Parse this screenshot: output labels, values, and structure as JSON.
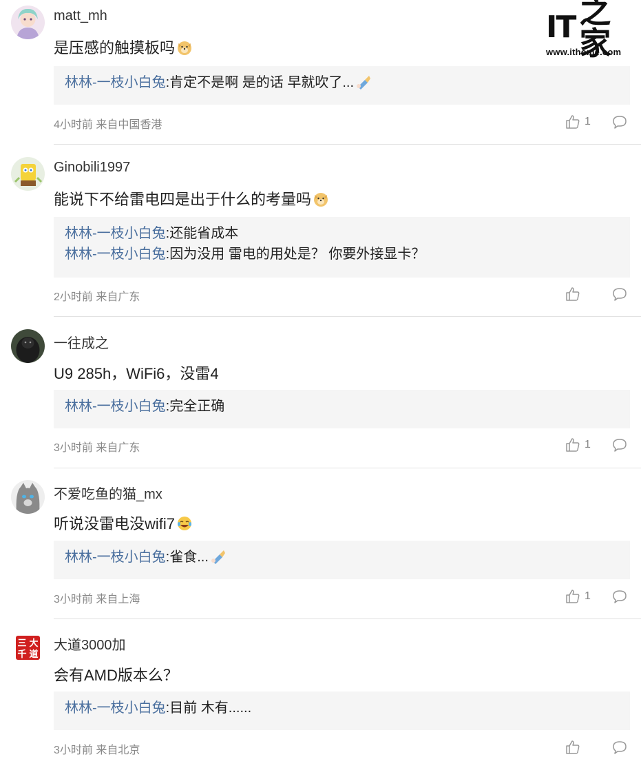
{
  "watermark": {
    "logo_text": "IT",
    "logo_hanzi": "之家",
    "url": "www.ithome.com"
  },
  "comments": [
    {
      "username": "matt_mh",
      "content": "是压感的触摸板吗",
      "content_emoji": "doge-emoji",
      "replies": [
        {
          "author": "林林-一枝小白兔",
          "text": ":肯定不是啊 是的话 早就吹了...",
          "emoji": "blow-horn-emoji"
        }
      ],
      "time": "4小时前 来自中国香港",
      "likes": "1"
    },
    {
      "username": "Ginobili1997",
      "content": "能说下不给雷电四是出于什么的考量吗",
      "content_emoji": "doge-emoji",
      "replies": [
        {
          "author": "林林-一枝小白兔",
          "text": ":还能省成本"
        },
        {
          "author": "林林-一枝小白兔",
          "text": ":因为没用 雷电的用处是？ 你要外接显卡？"
        }
      ],
      "time": "2小时前 来自广东",
      "likes": ""
    },
    {
      "username": "一往成之",
      "content": "U9 285h，WiFi6，没雷4",
      "content_emoji": "",
      "replies": [
        {
          "author": "林林-一枝小白兔",
          "text": ":完全正确"
        }
      ],
      "time": "3小时前 来自广东",
      "likes": "1"
    },
    {
      "username": "不爱吃鱼的猫_mx",
      "content": "听说没雷电没wifi7",
      "content_emoji": "laugh-cry-emoji",
      "replies": [
        {
          "author": "林林-一枝小白兔",
          "text": ":雀食...",
          "emoji": "blow-horn-emoji"
        }
      ],
      "time": "3小时前 来自上海",
      "likes": "1"
    },
    {
      "username": "大道3000加",
      "content": "会有AMD版本么？",
      "content_emoji": "",
      "replies": [
        {
          "author": "林林-一枝小白兔",
          "text": ":目前 木有......"
        }
      ],
      "time": "3小时前 来自北京",
      "likes": ""
    }
  ],
  "colors": {
    "reply_author": "#4a6f9e",
    "reply_bg": "#f5f5f5",
    "meta_text": "#888888",
    "divider": "#e2e2e2"
  },
  "avatar_seal_text": "三大千道"
}
